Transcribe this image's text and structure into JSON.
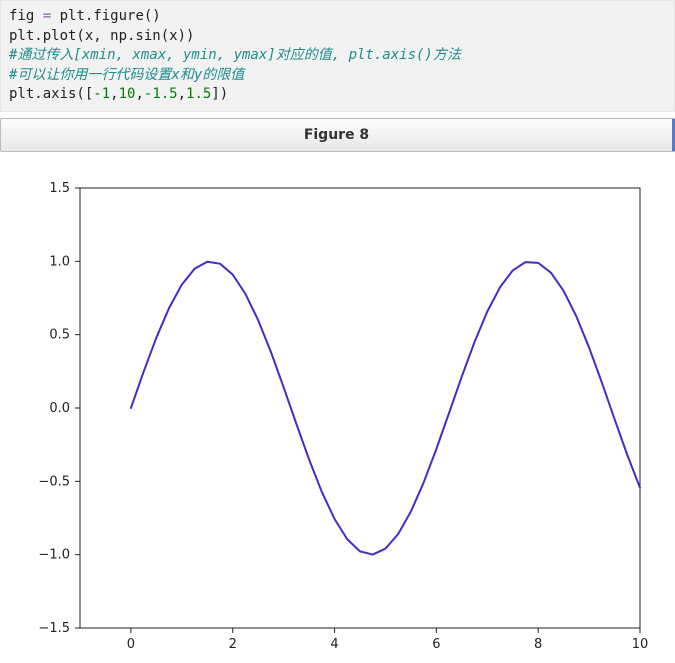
{
  "code": {
    "line1_a": "fig ",
    "line1_eq": "=",
    "line1_b": " plt.figure()",
    "line2_a": "plt.plot(x, np.sin(x))",
    "line3_comment": "#通过传入[xmin, xmax, ymin, ymax]对应的值, plt.axis()方法",
    "line4_comment": "#可以让你用一行代码设置x和y的限值",
    "line5_a": "plt.axis([",
    "line5_n1": "-1",
    "line5_c1": ",",
    "line5_n2": "10",
    "line5_c2": ",",
    "line5_n3": "-1.5",
    "line5_c3": ",",
    "line5_n4": "1.5",
    "line5_b": "])"
  },
  "figure_label": "Figure 8",
  "chart_data": {
    "type": "line",
    "title": "",
    "xlabel": "",
    "ylabel": "",
    "xlim": [
      -1,
      10
    ],
    "ylim": [
      -1.5,
      1.5
    ],
    "x_ticks": [
      0,
      2,
      4,
      6,
      8,
      10
    ],
    "y_ticks": [
      -1.5,
      -1.0,
      -0.5,
      0.0,
      0.5,
      1.0,
      1.5
    ],
    "y_tick_labels": [
      "−1.5",
      "−1.0",
      "−0.5",
      "0.0",
      "0.5",
      "1.0",
      "1.5"
    ],
    "grid": false,
    "legend": false,
    "series": [
      {
        "name": "sin(x)",
        "color": "#4a29c9",
        "x": [
          0.0,
          0.25,
          0.5,
          0.75,
          1.0,
          1.25,
          1.5,
          1.75,
          2.0,
          2.25,
          2.5,
          2.75,
          3.0,
          3.25,
          3.5,
          3.75,
          4.0,
          4.25,
          4.5,
          4.75,
          5.0,
          5.25,
          5.5,
          5.75,
          6.0,
          6.25,
          6.5,
          6.75,
          7.0,
          7.25,
          7.5,
          7.75,
          8.0,
          8.25,
          8.5,
          8.75,
          9.0,
          9.25,
          9.5,
          9.75,
          10.0
        ],
        "y": [
          0.0,
          0.2474,
          0.4794,
          0.6816,
          0.8415,
          0.949,
          0.9975,
          0.9839,
          0.9093,
          0.7781,
          0.5985,
          0.3817,
          0.1411,
          -0.1082,
          -0.3508,
          -0.5716,
          -0.7568,
          -0.895,
          -0.9775,
          -0.9993,
          -0.9589,
          -0.8589,
          -0.7055,
          -0.5083,
          -0.2794,
          -0.0332,
          0.2151,
          0.45,
          0.657,
          0.8231,
          0.938,
          0.9946,
          0.9894,
          0.9228,
          0.7985,
          0.6247,
          0.4121,
          0.1743,
          -0.0752,
          -0.3195,
          -0.544
        ]
      }
    ]
  }
}
